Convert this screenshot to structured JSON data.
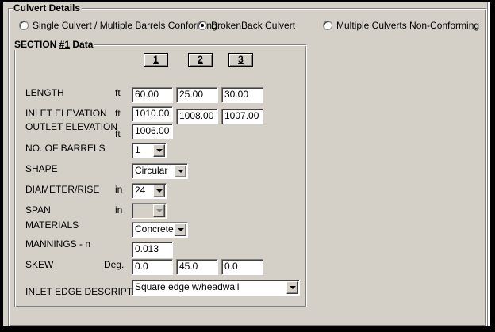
{
  "culvert_details": {
    "title": "Culvert Details",
    "radios": [
      {
        "label": "Single Culvert / Multiple Barrels Conforming",
        "checked": false
      },
      {
        "label": "BrokenBack Culvert",
        "checked": true
      },
      {
        "label": "Multiple Culverts Non-Conforming",
        "checked": false
      }
    ]
  },
  "section": {
    "title_prefix": "SECTION ",
    "title_underlined": "#1",
    "title_suffix": " Data",
    "columns": [
      "1",
      "2",
      "3"
    ]
  },
  "labels": {
    "length": "LENGTH",
    "inlet_elevation": "INLET ELEVATION",
    "outlet_elevation": "OUTLET ELEVATION",
    "no_of_barrels": "NO. OF BARRELS",
    "shape": "SHAPE",
    "diameter_rise": "DIAMETER/RISE",
    "span": "SPAN",
    "materials": "MATERIALS",
    "mannings_n": "MANNINGS - n",
    "skew": "SKEW",
    "inlet_edge_description": "INLET EDGE DESCRIPTION"
  },
  "units": {
    "length": "ft",
    "inlet_elevation": "ft",
    "outlet_elevation": "ft",
    "diameter_rise": "in",
    "span": "in",
    "skew": "Deg."
  },
  "values": {
    "length": [
      "60.00",
      "25.00",
      "30.00"
    ],
    "inlet_elevation": [
      "1010.00",
      "1008.00",
      "1007.00"
    ],
    "outlet_elevation": "1006.00",
    "no_of_barrels": "1",
    "shape": "Circular",
    "diameter_rise": "24",
    "span": "",
    "materials": "Concrete",
    "mannings_n": "0.013",
    "skew": [
      "0.0",
      "45.0",
      "0.0"
    ],
    "inlet_edge_description": "Square edge w/headwall"
  }
}
